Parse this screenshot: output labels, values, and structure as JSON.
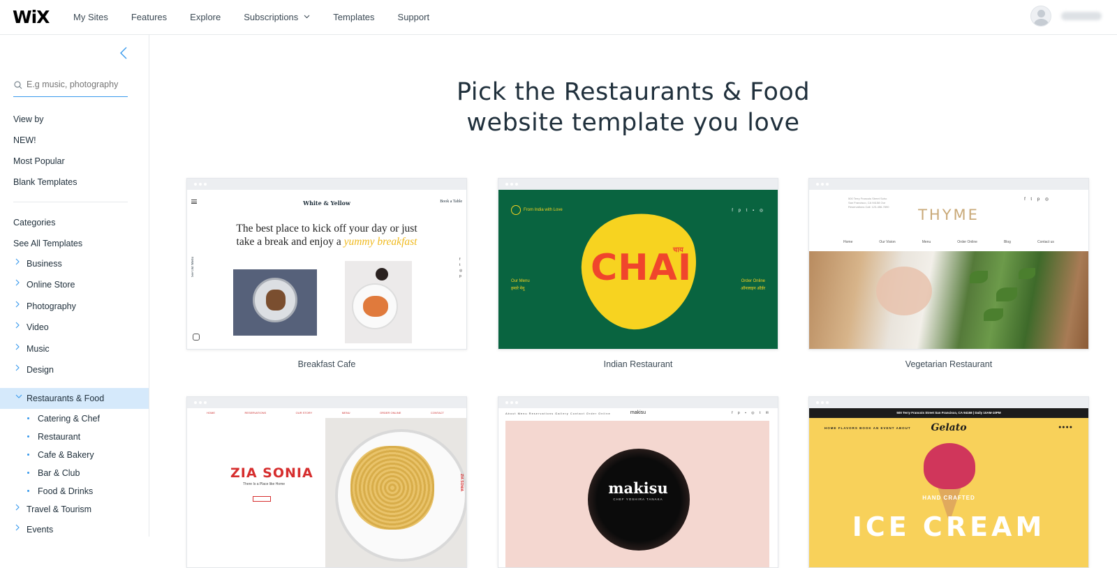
{
  "header": {
    "logo": "WiX",
    "nav": [
      "My Sites",
      "Features",
      "Explore",
      "Subscriptions",
      "Templates",
      "Support"
    ],
    "subscriptions_chevron": "⌄"
  },
  "sidebar": {
    "collapse_icon": "chevron-left-icon",
    "search_placeholder": "E.g music, photography",
    "view_by": "View by",
    "view_links": [
      "NEW!",
      "Most Popular",
      "Blank Templates"
    ],
    "categories_label": "Categories",
    "see_all": "See All Templates",
    "categories": [
      "Business",
      "Online Store",
      "Photography",
      "Video",
      "Music",
      "Design",
      "Restaurants & Food"
    ],
    "active_category": "Restaurants & Food",
    "subcategories": [
      "Catering & Chef",
      "Restaurant",
      "Cafe & Bakery",
      "Bar & Club",
      "Food & Drinks"
    ],
    "more_categories": [
      "Travel & Tourism",
      "Events"
    ],
    "accent_color": "#3899ec",
    "active_bg": "#d5e9fb"
  },
  "main": {
    "headline_line1": "Pick the Restaurants & Food",
    "headline_line2": "website template you love",
    "templates": [
      {
        "caption": "Breakfast Cafe",
        "preview": {
          "title": "White & Yellow",
          "book": "Book a Table",
          "tagline_1": "The best place to kick off your day or just",
          "tagline_2": "take a break and enjoy a",
          "tagline_accent": "yummy breakfast",
          "side": "See Our Menu"
        }
      },
      {
        "caption": "Indian Restaurant",
        "preview": {
          "word": "CHAI",
          "hindi": "चाय",
          "from": "From India with Love",
          "menu": "Our Menu",
          "menu_hi": "हमारे मेनू",
          "order": "Order Online",
          "order_hi": "ऑनलाइन ऑर्डर"
        }
      },
      {
        "caption": "Vegetarian Restaurant",
        "preview": {
          "name": "THYME",
          "address": "500 Terry Francois Street Soho San Francisco, CA 94158 Our Reservations Call: 123-456-7890",
          "nav": [
            "Home",
            "Our Vision",
            "Menu",
            "Order Online",
            "Blog",
            "Contact us"
          ]
        }
      },
      {
        "caption": "",
        "preview": {
          "title": "ZIA SONIA",
          "subtitle": "There Is a Place like Home",
          "button": "See Menu",
          "menu": [
            "HOME",
            "RESERVATIONS",
            "OUR STORY",
            "MENU",
            "ORDER ONLINE",
            "CONTACT"
          ],
          "vertical": "ZIA SONIA"
        }
      },
      {
        "caption": "",
        "preview": {
          "brand": "makisu",
          "word": "makisu",
          "chef": "CHEF YOSHIRA TANAKA",
          "links": "About  Menu  Reservations  Gallery  Contact  Order Online"
        }
      },
      {
        "caption": "",
        "preview": {
          "topbar": "500 Terry Francois Street San Francisco, CA 94158 | Daily 10AM-10PM",
          "logo": "Gelato",
          "nav": "HOME  FLAVORS  BOOK AN EVENT  ABOUT",
          "handcrafted": "HAND CRAFTED",
          "big": "ICE CREAM"
        }
      }
    ]
  }
}
